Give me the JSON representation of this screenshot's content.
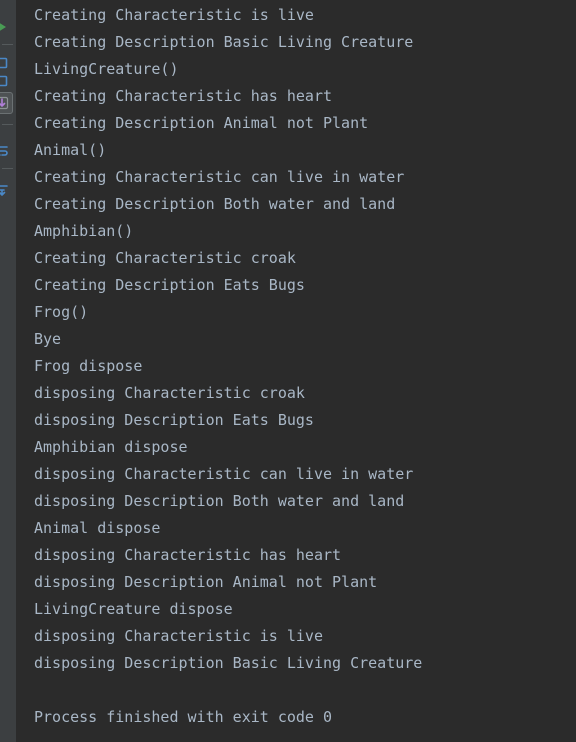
{
  "window": {
    "background_color": "#2b2b2b",
    "toolbar_background_color": "#3c3f41",
    "text_color": "#a9b7c6"
  },
  "run_toolbar": {
    "name": "run-tool-window-toolbar",
    "buttons": [
      {
        "icon": "rerun-icon",
        "label": "Rerun",
        "accent": "#499c54",
        "selected": false
      },
      {
        "icon": "stop-icon",
        "label": "Stop",
        "accent": "#4a88c7",
        "selected": false
      },
      {
        "icon": "trace-icon",
        "label": "Trace Current Stream Chain",
        "accent": "#b07fd8",
        "selected": true
      },
      {
        "icon": "soft-wrap-icon",
        "label": "Soft-Wrap",
        "accent": "#4a88c7",
        "selected": false
      },
      {
        "icon": "scroll-to-end-icon",
        "label": "Scroll to End",
        "accent": "#4a88c7",
        "selected": false
      },
      {
        "icon": "print-icon",
        "label": "Print",
        "accent": "#4a88c7",
        "selected": false
      }
    ]
  },
  "console": {
    "name": "run-console-output",
    "lines": [
      "Creating Characteristic is live",
      "Creating Description Basic Living Creature",
      "LivingCreature()",
      "Creating Characteristic has heart",
      "Creating Description Animal not Plant",
      "Animal()",
      "Creating Characteristic can live in water",
      "Creating Description Both water and land",
      "Amphibian()",
      "Creating Characteristic croak",
      "Creating Description Eats Bugs",
      "Frog()",
      "Bye",
      "Frog dispose",
      "disposing Characteristic croak",
      "disposing Description Eats Bugs",
      "Amphibian dispose",
      "disposing Characteristic can live in water",
      "disposing Description Both water and land",
      "Animal dispose",
      "disposing Characteristic has heart",
      "disposing Description Animal not Plant",
      "LivingCreature dispose",
      "disposing Characteristic is live",
      "disposing Description Basic Living Creature",
      "",
      "Process finished with exit code 0"
    ]
  }
}
